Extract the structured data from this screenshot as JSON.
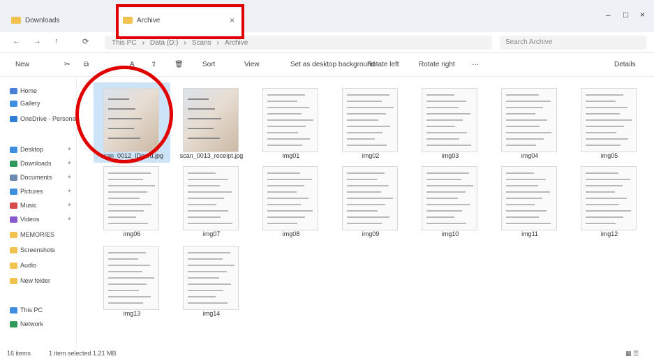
{
  "tabs": {
    "inactive_title": "Downloads",
    "active_title": "Archive",
    "close_glyph": "×"
  },
  "window_controls": {
    "minimize": "–",
    "maximize": "□",
    "close": "×"
  },
  "nav": {
    "back": "←",
    "forward": "→",
    "up": "↑",
    "refresh": "⟳",
    "path": [
      "This PC",
      "Data (D:)",
      "Scans",
      "Archive"
    ],
    "search_placeholder": "Search Archive",
    "expand_glyph": "⌄"
  },
  "command_bar": {
    "new": "New",
    "cut": "✂",
    "copy": "⧉",
    "paste": "📋",
    "rename": "A",
    "share": "⇪",
    "delete": "🗑",
    "sort": "Sort",
    "view": "View",
    "set_background": "Set as desktop background",
    "rotate_left": "Rotate left",
    "rotate_right": "Rotate right",
    "more": "···",
    "details": "Details"
  },
  "sidebar": {
    "items": [
      {
        "label": "Home",
        "icon": "home-icon",
        "color": "#4a7fd6",
        "pinned": false
      },
      {
        "label": "Gallery",
        "icon": "gallery-icon",
        "color": "#3f8fe0",
        "pinned": false
      },
      {
        "label": "OneDrive - Personal",
        "icon": "cloud-icon",
        "color": "#2f7fd6",
        "pinned": false
      },
      {
        "label": "Desktop",
        "icon": "desktop-icon",
        "color": "#3f8fe0",
        "pinned": true
      },
      {
        "label": "Downloads",
        "icon": "download-icon",
        "color": "#2f9a5a",
        "pinned": true
      },
      {
        "label": "Documents",
        "icon": "documents-icon",
        "color": "#6e8ab0",
        "pinned": true
      },
      {
        "label": "Pictures",
        "icon": "pictures-icon",
        "color": "#3f8fe0",
        "pinned": true
      },
      {
        "label": "Music",
        "icon": "music-icon",
        "color": "#d64a4a",
        "pinned": true
      },
      {
        "label": "Videos",
        "icon": "videos-icon",
        "color": "#8a58d0",
        "pinned": true
      },
      {
        "label": "MEMORIES",
        "icon": "folder-icon",
        "color": "#f2c24f",
        "pinned": false
      },
      {
        "label": "Screenshots",
        "icon": "folder-icon",
        "color": "#f2c24f",
        "pinned": false
      },
      {
        "label": "Audio",
        "icon": "folder-icon",
        "color": "#f2c24f",
        "pinned": false
      },
      {
        "label": "New folder",
        "icon": "folder-icon",
        "color": "#f2c24f",
        "pinned": false
      },
      {
        "label": "This PC",
        "icon": "pc-icon",
        "color": "#3f8fe0",
        "pinned": false
      },
      {
        "label": "Network",
        "icon": "network-icon",
        "color": "#2f9a5a",
        "pinned": false
      }
    ],
    "pin_glyph": "✦"
  },
  "files": [
    {
      "name": "scan_0012_IDcard.jpg",
      "kind": "photo",
      "selected": true
    },
    {
      "name": "scan_0013_receipt.jpg",
      "kind": "photo",
      "selected": false
    },
    {
      "name": "img01",
      "kind": "doc",
      "selected": false
    },
    {
      "name": "img02",
      "kind": "doc",
      "selected": false
    },
    {
      "name": "img03",
      "kind": "doc",
      "selected": false
    },
    {
      "name": "img04",
      "kind": "doc",
      "selected": false
    },
    {
      "name": "img05",
      "kind": "doc",
      "selected": false
    },
    {
      "name": "img06",
      "kind": "doc",
      "selected": false
    },
    {
      "name": "img07",
      "kind": "doc",
      "selected": false
    },
    {
      "name": "img08",
      "kind": "doc",
      "selected": false
    },
    {
      "name": "img09",
      "kind": "doc",
      "selected": false
    },
    {
      "name": "img10",
      "kind": "doc",
      "selected": false
    },
    {
      "name": "img11",
      "kind": "doc",
      "selected": false
    },
    {
      "name": "img12",
      "kind": "doc",
      "selected": false
    },
    {
      "name": "img13",
      "kind": "doc",
      "selected": false
    },
    {
      "name": "img14",
      "kind": "doc",
      "selected": false
    }
  ],
  "status": {
    "count": "16 items",
    "selection": "1 item selected  1.21 MB",
    "view_glyph": "▦ ☰"
  }
}
